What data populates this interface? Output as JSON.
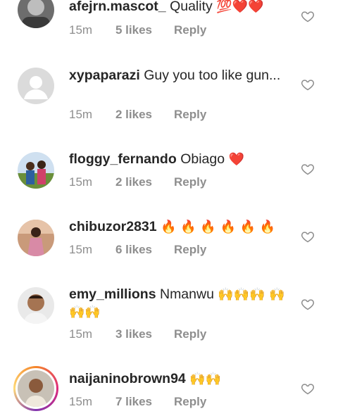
{
  "comments": [
    {
      "username": "afejrn.mascot_",
      "text": "Quality",
      "emoji": "💯❤️❤️",
      "time": "15m",
      "likes": "5 likes",
      "reply": "Reply"
    },
    {
      "username": "xypaparazi",
      "text": "Guy you too like gun...",
      "emoji": "",
      "time": "15m",
      "likes": "2 likes",
      "reply": "Reply"
    },
    {
      "username": "floggy_fernando",
      "text": "Obiago",
      "emoji": "❤️",
      "time": "15m",
      "likes": "2 likes",
      "reply": "Reply"
    },
    {
      "username": "chibuzor2831",
      "text": "",
      "emoji": "🔥 🔥 🔥 🔥 🔥 🔥",
      "time": "15m",
      "likes": "6 likes",
      "reply": "Reply"
    },
    {
      "username": "emy_millions",
      "text": "Nmanwu",
      "emoji": "🙌🙌🙌 🙌🙌🙌",
      "time": "15m",
      "likes": "3 likes",
      "reply": "Reply"
    },
    {
      "username": "naijaninobrown94",
      "text": "",
      "emoji": "🙌🙌",
      "time": "15m",
      "likes": "7 likes",
      "reply": "Reply"
    }
  ],
  "colors": {
    "emoji_red": "#e0245e",
    "emoji_fire": "#f4900c",
    "emoji_hands": "#ffcc33",
    "meta": "#8e8e8e"
  }
}
